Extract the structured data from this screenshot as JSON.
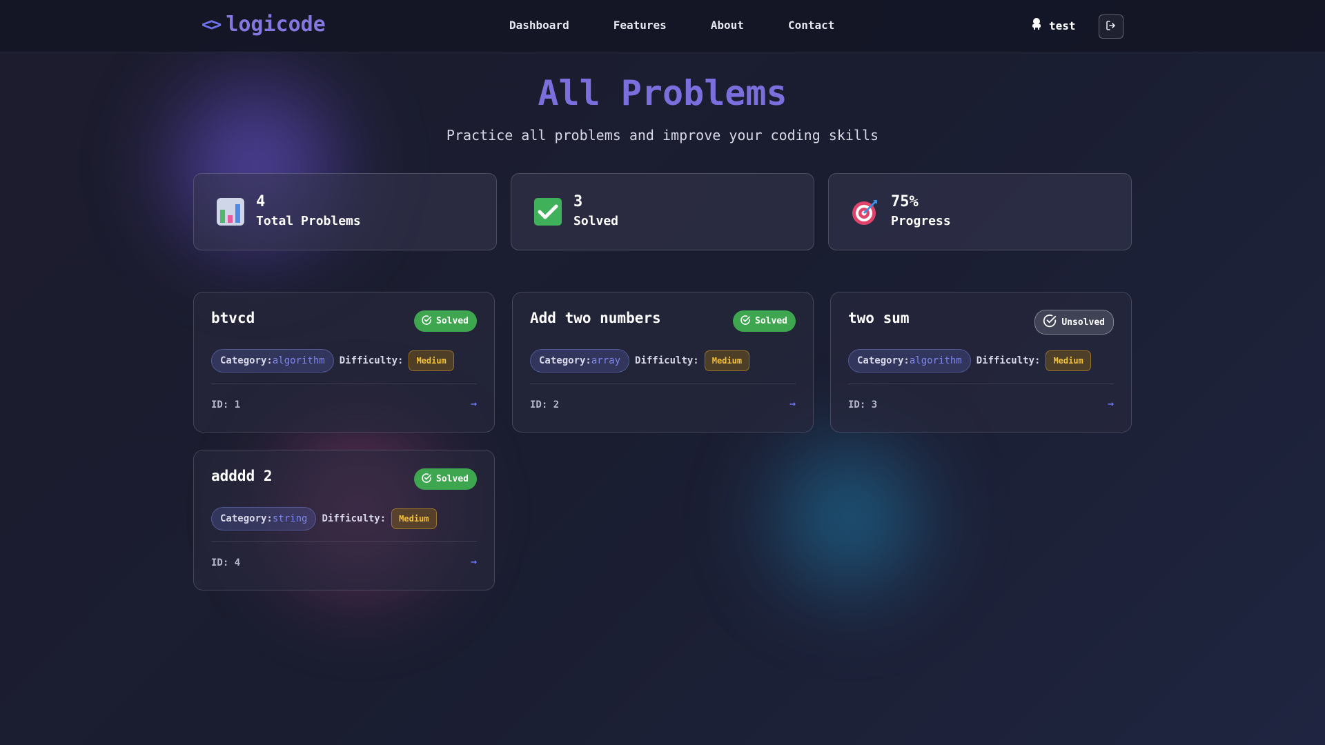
{
  "header": {
    "logo_icon": "<>",
    "logo_text": "logicode",
    "nav": [
      "Dashboard",
      "Features",
      "About",
      "Contact"
    ],
    "user_icon": "user-icon",
    "user_name": "test",
    "logout_icon": "logout-icon"
  },
  "main": {
    "title": "All Problems",
    "subtitle": "Practice all problems and improve your coding skills"
  },
  "stats": [
    {
      "icon": "bar-chart-icon",
      "value": "4",
      "label": "Total Problems"
    },
    {
      "icon": "check-mark-icon",
      "value": "3",
      "label": "Solved"
    },
    {
      "icon": "target-icon",
      "value": "75%",
      "label": "Progress"
    }
  ],
  "problems": [
    {
      "title": "btvcd",
      "status": "Solved",
      "category_label": "Category:",
      "category": "algorithm",
      "difficulty_label": "Difficulty:",
      "difficulty": "Medium",
      "id": "ID: 1",
      "arrow": "→"
    },
    {
      "title": "Add two numbers",
      "status": "Solved",
      "category_label": "Category:",
      "category": "array",
      "difficulty_label": "Difficulty:",
      "difficulty": "Medium",
      "id": "ID: 2",
      "arrow": "→"
    },
    {
      "title": "two sum",
      "status": "Unsolved",
      "category_label": "Category:",
      "category": "algorithm",
      "difficulty_label": "Difficulty:",
      "difficulty": "Medium",
      "id": "ID: 3",
      "arrow": "→"
    },
    {
      "title": "adddd 2",
      "status": "Solved",
      "category_label": "Category:",
      "category": "string",
      "difficulty_label": "Difficulty:",
      "difficulty": "Medium",
      "id": "ID: 4",
      "arrow": "→"
    }
  ],
  "colors": {
    "accent": "#7a6fdc",
    "solved": "#3fa650",
    "difficulty_medium": "#f3c13a",
    "category": "#7c86ea"
  }
}
